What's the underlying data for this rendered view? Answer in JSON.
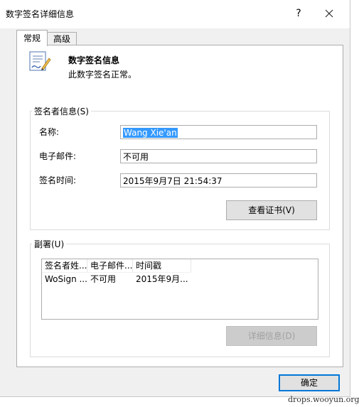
{
  "window": {
    "title": "数字签名详细信息",
    "help_glyph": "?",
    "close_glyph": "✕"
  },
  "tabs": [
    {
      "label": "常规"
    },
    {
      "label": "高级"
    }
  ],
  "signature_info": {
    "title": "数字签名信息",
    "status": "此数字签名正常。"
  },
  "signer_group": {
    "label": "签名者信息(S)",
    "name_label": "名称:",
    "name_value": "Wang Xie'an",
    "email_label": "电子邮件:",
    "email_value": "不可用",
    "time_label": "签名时间:",
    "time_value": "2015年9月7日 21:54:37",
    "view_cert_button": "查看证书(V)"
  },
  "countersign_group": {
    "label": "副署(U)",
    "columns": [
      "签名者姓...",
      "电子邮件...",
      "时间戳"
    ],
    "rows": [
      [
        "WoSign ...",
        "不可用",
        "2015年9月..."
      ]
    ],
    "details_button": "详细信息(D)"
  },
  "ok_button": "确定",
  "watermark": "drops.wooyun.org",
  "colors": {
    "selection": "#3399ff",
    "focus_border": "#0078d7"
  }
}
